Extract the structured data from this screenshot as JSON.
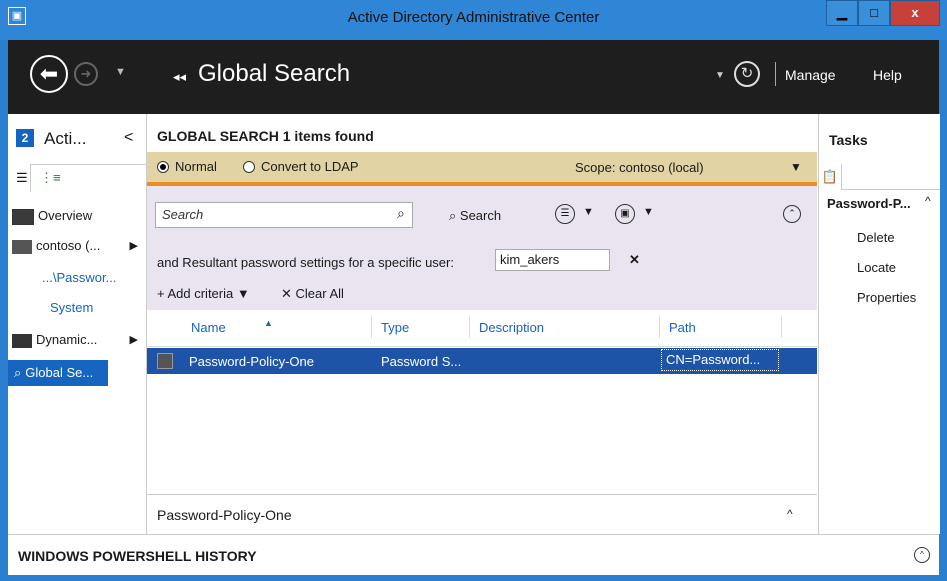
{
  "window": {
    "title": "Active Directory Administrative Center",
    "app_icon": "adac-icon",
    "min": "▁",
    "max": "□",
    "close": "x"
  },
  "nav": {
    "back": "⬅",
    "forward": "➜",
    "history_drop": "▼",
    "breadcrumb_arrows": "◂◂",
    "breadcrumb": "Global Search",
    "breadcrumb_drop": "▼",
    "refresh": "↻",
    "manage": "Manage",
    "help": "Help"
  },
  "left_pane": {
    "title": "Acti...",
    "collapse": "<",
    "items": [
      {
        "label": "Overview"
      },
      {
        "label": "contoso (...",
        "arrow": "▶"
      },
      {
        "label": "...\\Passwor..."
      },
      {
        "label": "System"
      },
      {
        "label": "Dynamic...",
        "arrow": "▶"
      },
      {
        "label": "Global Se..."
      }
    ]
  },
  "global_search": {
    "title": "GLOBAL SEARCH  1 items found",
    "mode_normal": "Normal",
    "mode_ldap": "Convert to LDAP",
    "scope_label": "Scope:  contoso (local)",
    "scope_drop": "▼",
    "search_placeholder": "Search",
    "search_button": "Search",
    "criteria_label": "and Resultant password settings for a specific user:",
    "criteria_value": "kim_akers",
    "criteria_remove": "✕",
    "add_criteria": "+ Add criteria ▼",
    "clear_all": "✕  Clear All",
    "columns": {
      "name": "Name",
      "type": "Type",
      "description": "Description",
      "path": "Path"
    },
    "rows": [
      {
        "name": "Password-Policy-One",
        "type": "Password S...",
        "description": "",
        "path": "CN=Password..."
      }
    ],
    "preview_title": "Password-Policy-One",
    "preview_toggle": "^"
  },
  "tasks": {
    "title": "Tasks",
    "group": "Password-P...",
    "group_toggle": "^",
    "items": [
      "Delete",
      "Locate",
      "Properties"
    ]
  },
  "powershell": {
    "title": "WINDOWS POWERSHELL HISTORY",
    "toggle": "^"
  }
}
